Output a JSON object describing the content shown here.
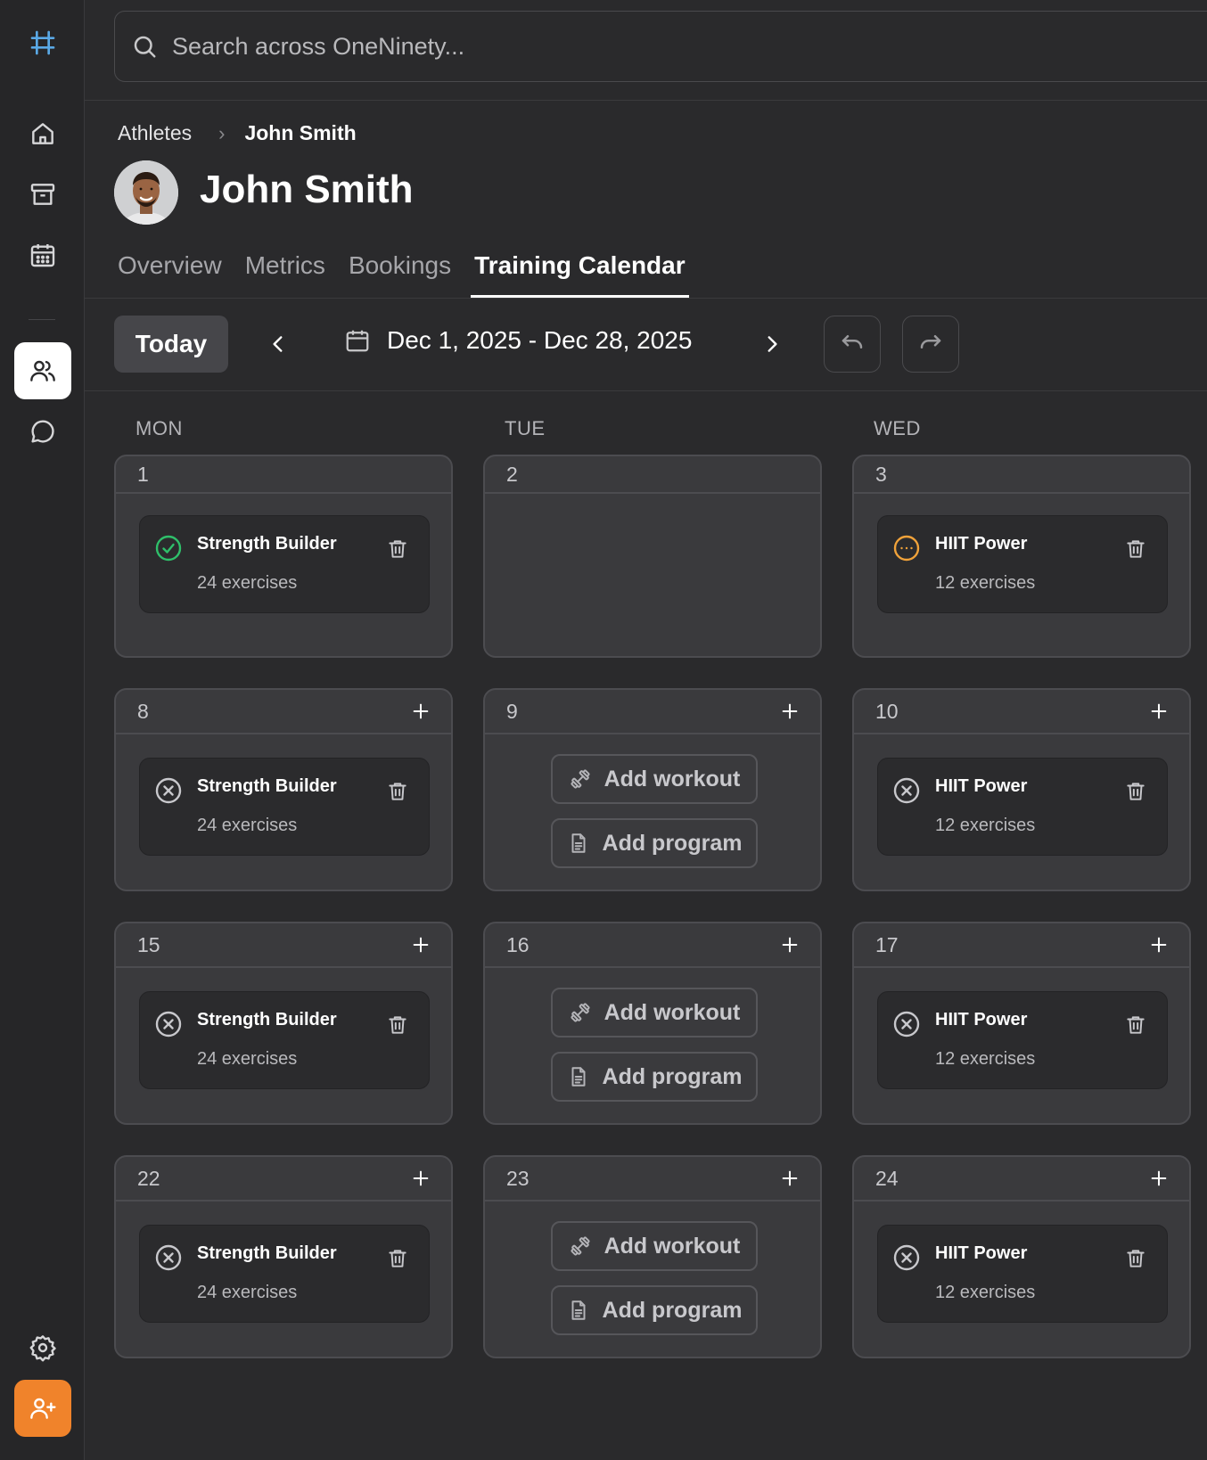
{
  "app": {
    "search_placeholder": "Search across OneNinety..."
  },
  "sidebar": {
    "items": [
      {
        "icon": "logo-hash-icon"
      },
      {
        "icon": "home-icon"
      },
      {
        "icon": "archive-icon"
      },
      {
        "icon": "calendar-icon"
      },
      {
        "icon": "users-icon",
        "active": true
      },
      {
        "icon": "chat-icon"
      },
      {
        "icon": "gear-icon"
      },
      {
        "icon": "add-user-icon"
      }
    ],
    "accent_color": "#f0832b"
  },
  "breadcrumb": {
    "parent": "Athletes",
    "current": "John Smith"
  },
  "profile": {
    "name": "John Smith"
  },
  "tabs": [
    {
      "label": "Overview",
      "active": false
    },
    {
      "label": "Metrics",
      "active": false
    },
    {
      "label": "Bookings",
      "active": false
    },
    {
      "label": "Training Calendar",
      "active": true
    }
  ],
  "toolbar": {
    "today_label": "Today",
    "date_range": "Dec 1, 2025 - Dec 28, 2025"
  },
  "calendar": {
    "weekdays": [
      "MON",
      "TUE",
      "WED"
    ],
    "status_colors": {
      "completed": "#2fbf6a",
      "in_progress": "#f0a23a",
      "missed": "#c8c8cc"
    },
    "add_workout_label": "Add workout",
    "add_program_label": "Add program",
    "weeks": [
      [
        {
          "day": "1",
          "workout": {
            "title": "Strength Builder",
            "subtitle": "24 exercises",
            "status": "completed"
          }
        },
        {
          "day": "2"
        },
        {
          "day": "3",
          "workout": {
            "title": "HIIT Power",
            "subtitle": "12 exercises",
            "status": "in_progress"
          }
        }
      ],
      [
        {
          "day": "8",
          "workout": {
            "title": "Strength Builder",
            "subtitle": "24 exercises",
            "status": "missed"
          }
        },
        {
          "day": "9"
        },
        {
          "day": "10",
          "workout": {
            "title": "HIIT Power",
            "subtitle": "12 exercises",
            "status": "missed"
          }
        }
      ],
      [
        {
          "day": "15",
          "workout": {
            "title": "Strength Builder",
            "subtitle": "24 exercises",
            "status": "missed"
          }
        },
        {
          "day": "16"
        },
        {
          "day": "17",
          "workout": {
            "title": "HIIT Power",
            "subtitle": "12 exercises",
            "status": "missed"
          }
        }
      ],
      [
        {
          "day": "22",
          "workout": {
            "title": "Strength Builder",
            "subtitle": "24 exercises",
            "status": "missed"
          }
        },
        {
          "day": "23"
        },
        {
          "day": "24",
          "workout": {
            "title": "HIIT Power",
            "subtitle": "12 exercises",
            "status": "missed"
          }
        }
      ]
    ]
  }
}
